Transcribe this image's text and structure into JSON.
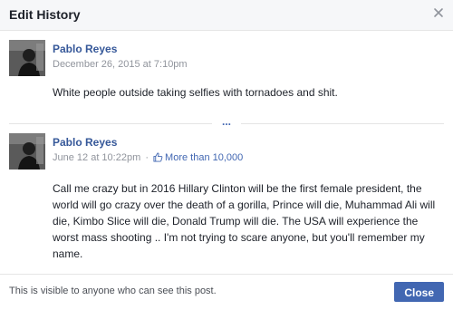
{
  "dialog": {
    "title": "Edit History",
    "close_icon": "close-icon"
  },
  "entries": [
    {
      "author": "Pablo Reyes",
      "timestamp": "December 26, 2015 at 7:10pm",
      "text": "White people outside taking selfies with tornadoes and shit."
    },
    {
      "author": "Pablo Reyes",
      "timestamp": "June 12 at 10:22pm",
      "separator": "·",
      "like_icon": "thumbs-up-icon",
      "likes": "More than 10,000",
      "text": "Call me crazy but in 2016 Hillary Clinton will be the first female president, the world will go crazy over the death of a gorilla, Prince will die, Muhammad Ali will die, Kimbo Slice will die, Donald Trump will die. The USA will experience the worst mass shooting .. I'm not trying to scare anyone, but you'll remember my name."
    }
  ],
  "more_indicator": "...",
  "footer": {
    "note": "This is visible to anyone who can see this post.",
    "close_label": "Close"
  },
  "colors": {
    "link": "#365899",
    "accent": "#4267b2",
    "meta": "#90949c",
    "header_bg": "#f6f7f9"
  }
}
